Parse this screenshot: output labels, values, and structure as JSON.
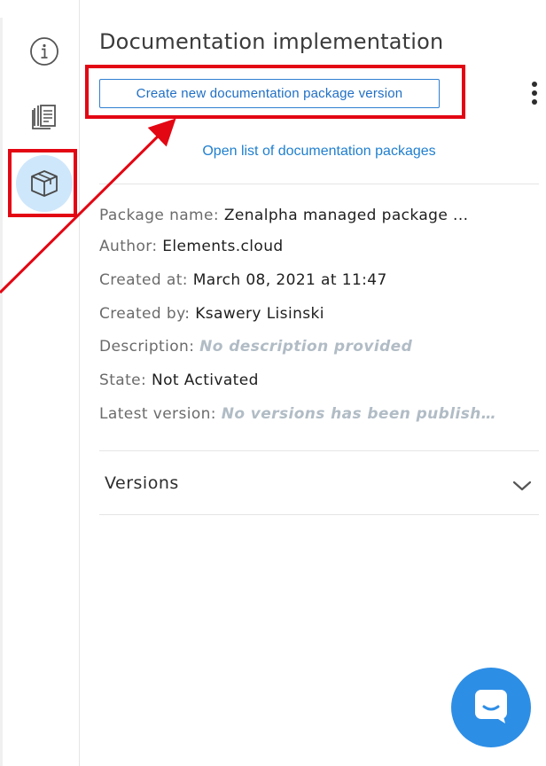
{
  "panel": {
    "title": "Documentation implementation",
    "create_button_label": "Create new documentation package version",
    "open_list_link": "Open list of documentation packages"
  },
  "details": {
    "package_name": {
      "label": "Package name:",
      "value": "Zenalpha managed package ..."
    },
    "author": {
      "label": "Author:",
      "value": "Elements.cloud"
    },
    "created_at": {
      "label": "Created at:",
      "value": "March 08, 2021 at 11:47"
    },
    "created_by": {
      "label": "Created by:",
      "value": "Ksawery Lisinski"
    },
    "description": {
      "label": "Description:",
      "value": "No description provided"
    },
    "state": {
      "label": "State:",
      "value": "Not Activated"
    },
    "latest_version": {
      "label": "Latest version:",
      "value": "No versions has been publish…"
    }
  },
  "versions": {
    "label": "Versions"
  },
  "icons": {
    "rail": [
      "info-icon",
      "documents-icon",
      "package-icon"
    ],
    "kebab": "more-vertical-icon",
    "chevron": "chevron-down-icon",
    "chat": "chat-icon"
  },
  "colors": {
    "accent": "#2f7fd1",
    "link": "#1f7fcf",
    "annotation": "#e30613",
    "active_rail_bg": "#cfe7fb",
    "chat_fab": "#2d8ee6"
  }
}
